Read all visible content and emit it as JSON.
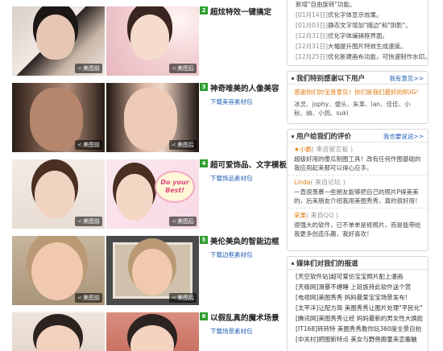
{
  "features": [
    {
      "num": "2",
      "title": "超炫特效一键搞定",
      "link": "",
      "before": "美图前",
      "after": "美图后"
    },
    {
      "num": "3",
      "title": "神奇唯美的人像美容",
      "link": "下载美容素材包",
      "before": "美图前",
      "after": "美图后"
    },
    {
      "num": "4",
      "title": "超可爱饰品、文字模板",
      "link": "下载饰品素材包",
      "before": "美图前",
      "after": "美图后"
    },
    {
      "num": "5",
      "title": "美伦美奂的智能边框",
      "link": "下载边框素材包",
      "before": "美图前",
      "after": "美图后"
    },
    {
      "num": "6",
      "title": "以假乱真的魔术场景",
      "link": "下载场景素材包",
      "before": "美图前",
      "after": "美图后"
    }
  ],
  "sticker_text": "Do your Best!",
  "updates": [
    {
      "date": "",
      "text": "新增\"自由旋转\"功能。"
    },
    {
      "date": "[01月14日]",
      "text": "优化字体显示效果。"
    },
    {
      "date": "[01月03日]",
      "text": "静态文字增加\"描边\"和\"阴影\"。"
    },
    {
      "date": "[12月31日]",
      "text": "优化字体编辑框界面。"
    },
    {
      "date": "[12月31日]",
      "text": "大幅提升图片特效生成速度。"
    },
    {
      "date": "[12月25日]",
      "text": "优化新建画布功能，可快速制作水印。"
    },
    {
      "date": "[12月24日]",
      "text": "优化字体类型实体化显示。"
    }
  ],
  "thanks": {
    "title": "我们特别感谢以下用户",
    "more": "我有意见>>",
    "note": "感谢你们的宝贵意见！你们是我们最好的BUG!",
    "users": "冰灵、jophy、便头、朱革、lan、佳佳、小秋、纳、小鸽、suki"
  },
  "reviews": {
    "title": "用户给我们的评价",
    "more": "我也要说说>>",
    "items": [
      {
        "name": "★小鹏",
        "source": "( 来自留言板 )",
        "text": "超级好用的傻瓜制图工具！改有任何作图基础的我应用起来都可以得心应手。"
      },
      {
        "name": "Linda",
        "source": "( 来自论坛 )",
        "text": "一直很羡慕一些朋友能够把自己的照片P得美美的，后来朋友介绍我用美图秀秀，真的很好用！"
      },
      {
        "name": "采果",
        "source": "( 来自QQ )",
        "text": "很强大的软件，已不单单是修照片，而是能带给我更多创造乐趣，我好喜欢！"
      }
    ]
  },
  "media": {
    "title": "媒体们对我们的报道",
    "items": [
      {
        "src": "[天空软件站]",
        "text": "超可爱仿宝宝照片配上漫画"
      },
      {
        "src": "[天极网]",
        "text": "滑暴不缠睡 上班族持此软件送个赏"
      },
      {
        "src": "[电视网]",
        "text": "美图秀秀 妈妈最爱宝宝场景发布!"
      },
      {
        "src": "[太平洋]",
        "text": "让配方简 美图秀秀让图片处理\"平民化\""
      },
      {
        "src": "[腾讯网]",
        "text": "美图秀秀让经 妈妈最新的男女性大换脸"
      },
      {
        "src": "[IT168]",
        "text": "转转特 美图秀秀教你玩360度全景自拍"
      },
      {
        "src": "[中关村]",
        "text": "把图新特点 美女与野兽跟童来恋搬触"
      }
    ]
  }
}
